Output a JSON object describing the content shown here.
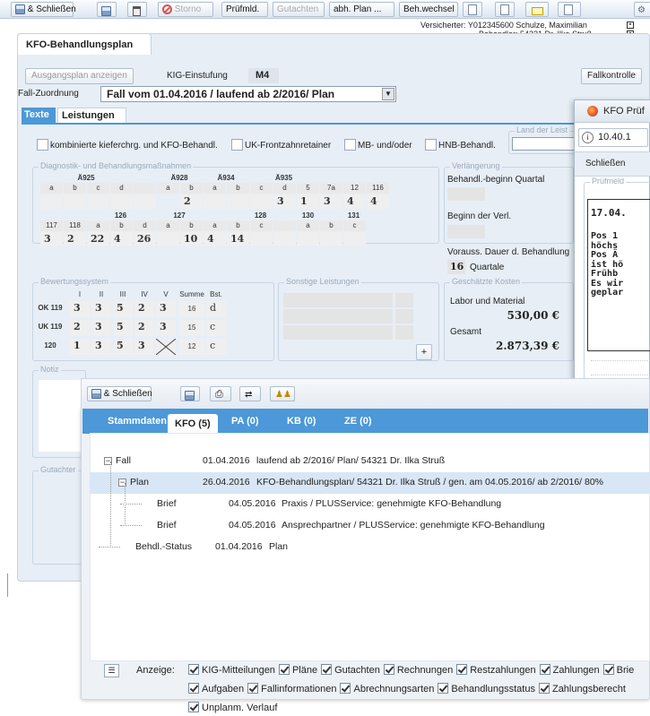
{
  "toolbar": {
    "close_label": "& Schließen",
    "storno_label": "Storno",
    "pruefmld_label": "Prüfmld.",
    "gutachten_label": "Gutachten",
    "abh_plan_label": "abh. Plan ...",
    "beh_wechsel_label": "Beh.wechsel",
    "insured_info": "Versicherter: Y012345600 Schulze, Maximilian",
    "practitioner_info": "Behandler: 54321 Dr. Ilka Struß"
  },
  "main": {
    "tab_title": "KFO-Behandlungsplan",
    "show_initial_plan_button": "Ausgangsplan anzeigen",
    "kig_label": "KIG-Einstufung",
    "kig_value": "M4",
    "fallkontrolle_button": "Fallkontrolle",
    "fall_zuordnung_label": "Fall-Zuordnung",
    "fall_value": "Fall vom 01.04.2016 / laufend ab 2/2016/ Plan",
    "tabs": [
      "Texte",
      "Leistungen"
    ],
    "checkboxes": [
      "kombinierte kieferchrg. und KFO-Behandl.",
      "UK-Frontzahnretainer",
      "MB- und/oder",
      "HNB-Behandl."
    ],
    "land_label": "Land der Leist",
    "diagnostik_legend": "Diagnostik- und Behandlungsmaßnahmen",
    "verlaengerung_legend": "Verlängerung",
    "behandl_beginn_label": "Behandl.-beginn Quartal",
    "beginn_verl_label": "Beginn der Verl.",
    "vorauss_dauer_label": "Vorauss. Dauer d. Behandlung",
    "dauer_value": "16",
    "dauer_unit": "Quartale",
    "bewertung_legend": "Bewertungssystem",
    "sonstige_legend": "Sonstige Leistungen",
    "kosten_legend": "Geschätzte Kosten",
    "labor_label": "Labor und Material",
    "labor_value": "530,00 €",
    "gesamt_label": "Gesamt",
    "gesamt_value": "2.873,39 €",
    "plus_button": "+",
    "notiz_legend": "Notiz",
    "gutachten_legend": "Gutachter"
  },
  "diag_table": {
    "row1_groups": [
      "Ä925",
      "Ä928",
      "Ä934",
      "Ä935"
    ],
    "row1_subs": [
      "a",
      "b",
      "c",
      "d",
      "",
      "a",
      "b",
      "a",
      "b",
      "c",
      "d",
      "5",
      "7a",
      "12",
      "116"
    ],
    "row1_values": [
      "",
      "",
      "",
      "",
      "",
      "2",
      "",
      "",
      "",
      "3",
      "1",
      "3",
      "4",
      "4"
    ],
    "row2_groups": [
      "126",
      "127",
      "128",
      "130",
      "131"
    ],
    "row2_subs": [
      "117",
      "118",
      "a",
      "b",
      "d",
      "a",
      "b",
      "a",
      "b",
      "c",
      "",
      "a",
      "b",
      "c"
    ],
    "row2_values": [
      "3",
      "2",
      "22",
      "4",
      "26",
      "",
      "10",
      "4",
      "14"
    ]
  },
  "bewertung": {
    "headers": [
      "I",
      "II",
      "III",
      "IV",
      "V",
      "Summe",
      "Bst."
    ],
    "rows": [
      {
        "label": "OK 119",
        "vals": [
          "3",
          "3",
          "5",
          "2",
          "3"
        ],
        "sum": "16",
        "bst": "d"
      },
      {
        "label": "UK 119",
        "vals": [
          "2",
          "3",
          "5",
          "2",
          "3"
        ],
        "sum": "15",
        "bst": "c"
      },
      {
        "label": "120",
        "vals": [
          "1",
          "3",
          "5",
          "3",
          ""
        ],
        "sum": "12",
        "bst": "c"
      }
    ]
  },
  "panel": {
    "close_label": "& Schließen",
    "tabs": [
      "Stammdaten",
      "KFO (5)",
      "PA (0)",
      "KB (0)",
      "ZE (0)"
    ],
    "tree": [
      {
        "name": "Fall",
        "date": "01.04.2016",
        "text": "laufend ab 2/2016/ Plan/ 54321 Dr. Ilka Struß"
      },
      {
        "name": "Plan",
        "date": "26.04.2016",
        "text": "KFO-Behandlungsplan/ 54321 Dr. Ilka Struß / gen. am 04.05.2016/ ab 2/2016/ 80%"
      },
      {
        "name": "Brief",
        "date": "04.05.2016",
        "text": "Praxis / PLUSService: genehmigte KFO-Behandlung"
      },
      {
        "name": "Brief",
        "date": "04.05.2016",
        "text": "Ansprechpartner / PLUSService: genehmigte KFO-Behandlung"
      },
      {
        "name": "Behdl.-Status",
        "date": "01.04.2016",
        "text": "Plan"
      }
    ],
    "anzeige_label": "Anzeige:",
    "filters_row1": [
      "KIG-Mitteilungen",
      "Pläne",
      "Gutachten",
      "Rechnungen",
      "Restzahlungen",
      "Zahlungen",
      "Brie"
    ],
    "filters_row2": [
      "Aufgaben",
      "Fallinformationen",
      "Abrechnungsarten",
      "Behandlungsstatus",
      "Zahlungsberecht"
    ],
    "filters_row3": [
      "Unplanm. Verlauf"
    ]
  },
  "popup": {
    "title": "KFO Prüf",
    "address": "10.40.1",
    "close_button": "Schließen",
    "legend": "Prüfmeld",
    "date": "17.04.",
    "lines": [
      "Pos 1",
      "höchs",
      "Pos Ä",
      "ist hö",
      "Frühb",
      "Es wir",
      "geplar"
    ]
  }
}
